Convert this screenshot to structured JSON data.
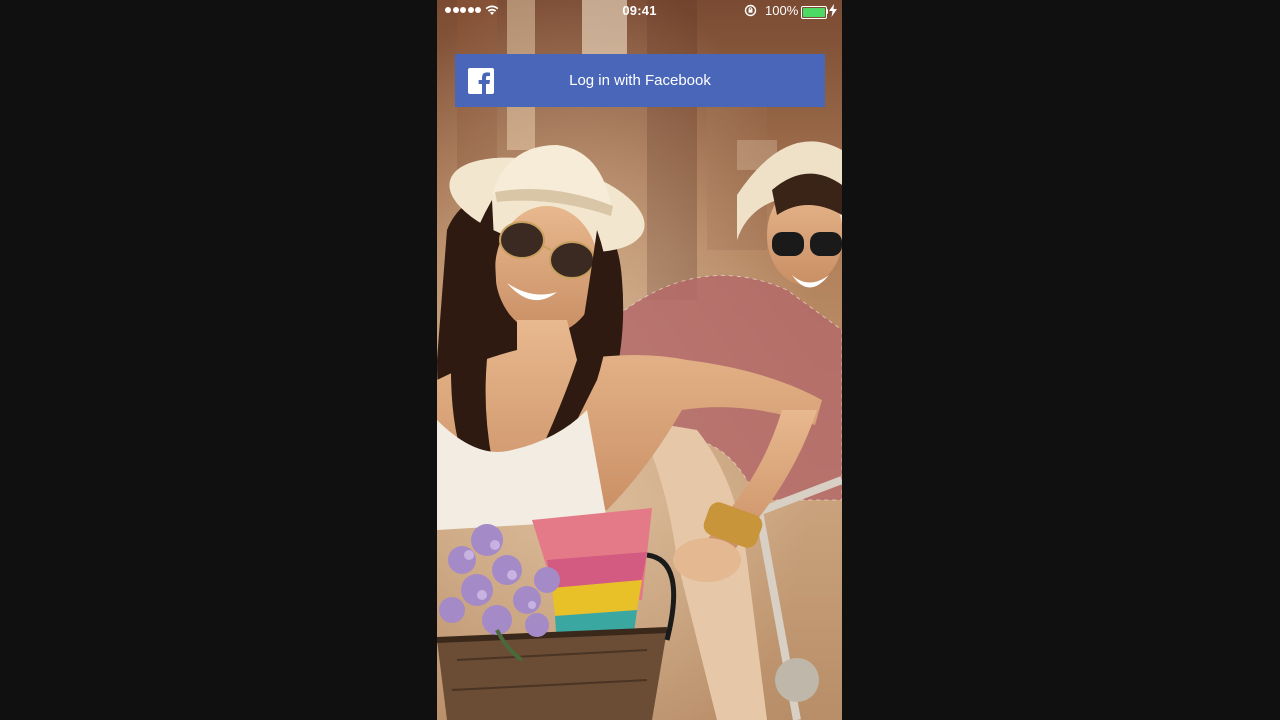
{
  "status_bar": {
    "time": "09:41",
    "battery_percent": "100%",
    "signal_bars": 5,
    "battery_level": 1.0,
    "battery_color": "#4cd964",
    "icons": [
      "signal-dots-icon",
      "wifi-icon",
      "rotation-lock-icon",
      "battery-icon",
      "charging-bolt-icon"
    ]
  },
  "login": {
    "facebook_label": "Log in with Facebook",
    "facebook_icon": "facebook-f-icon",
    "button_color": "#4a66b8"
  },
  "background": {
    "photo": "couple-on-bicycles-photo"
  }
}
